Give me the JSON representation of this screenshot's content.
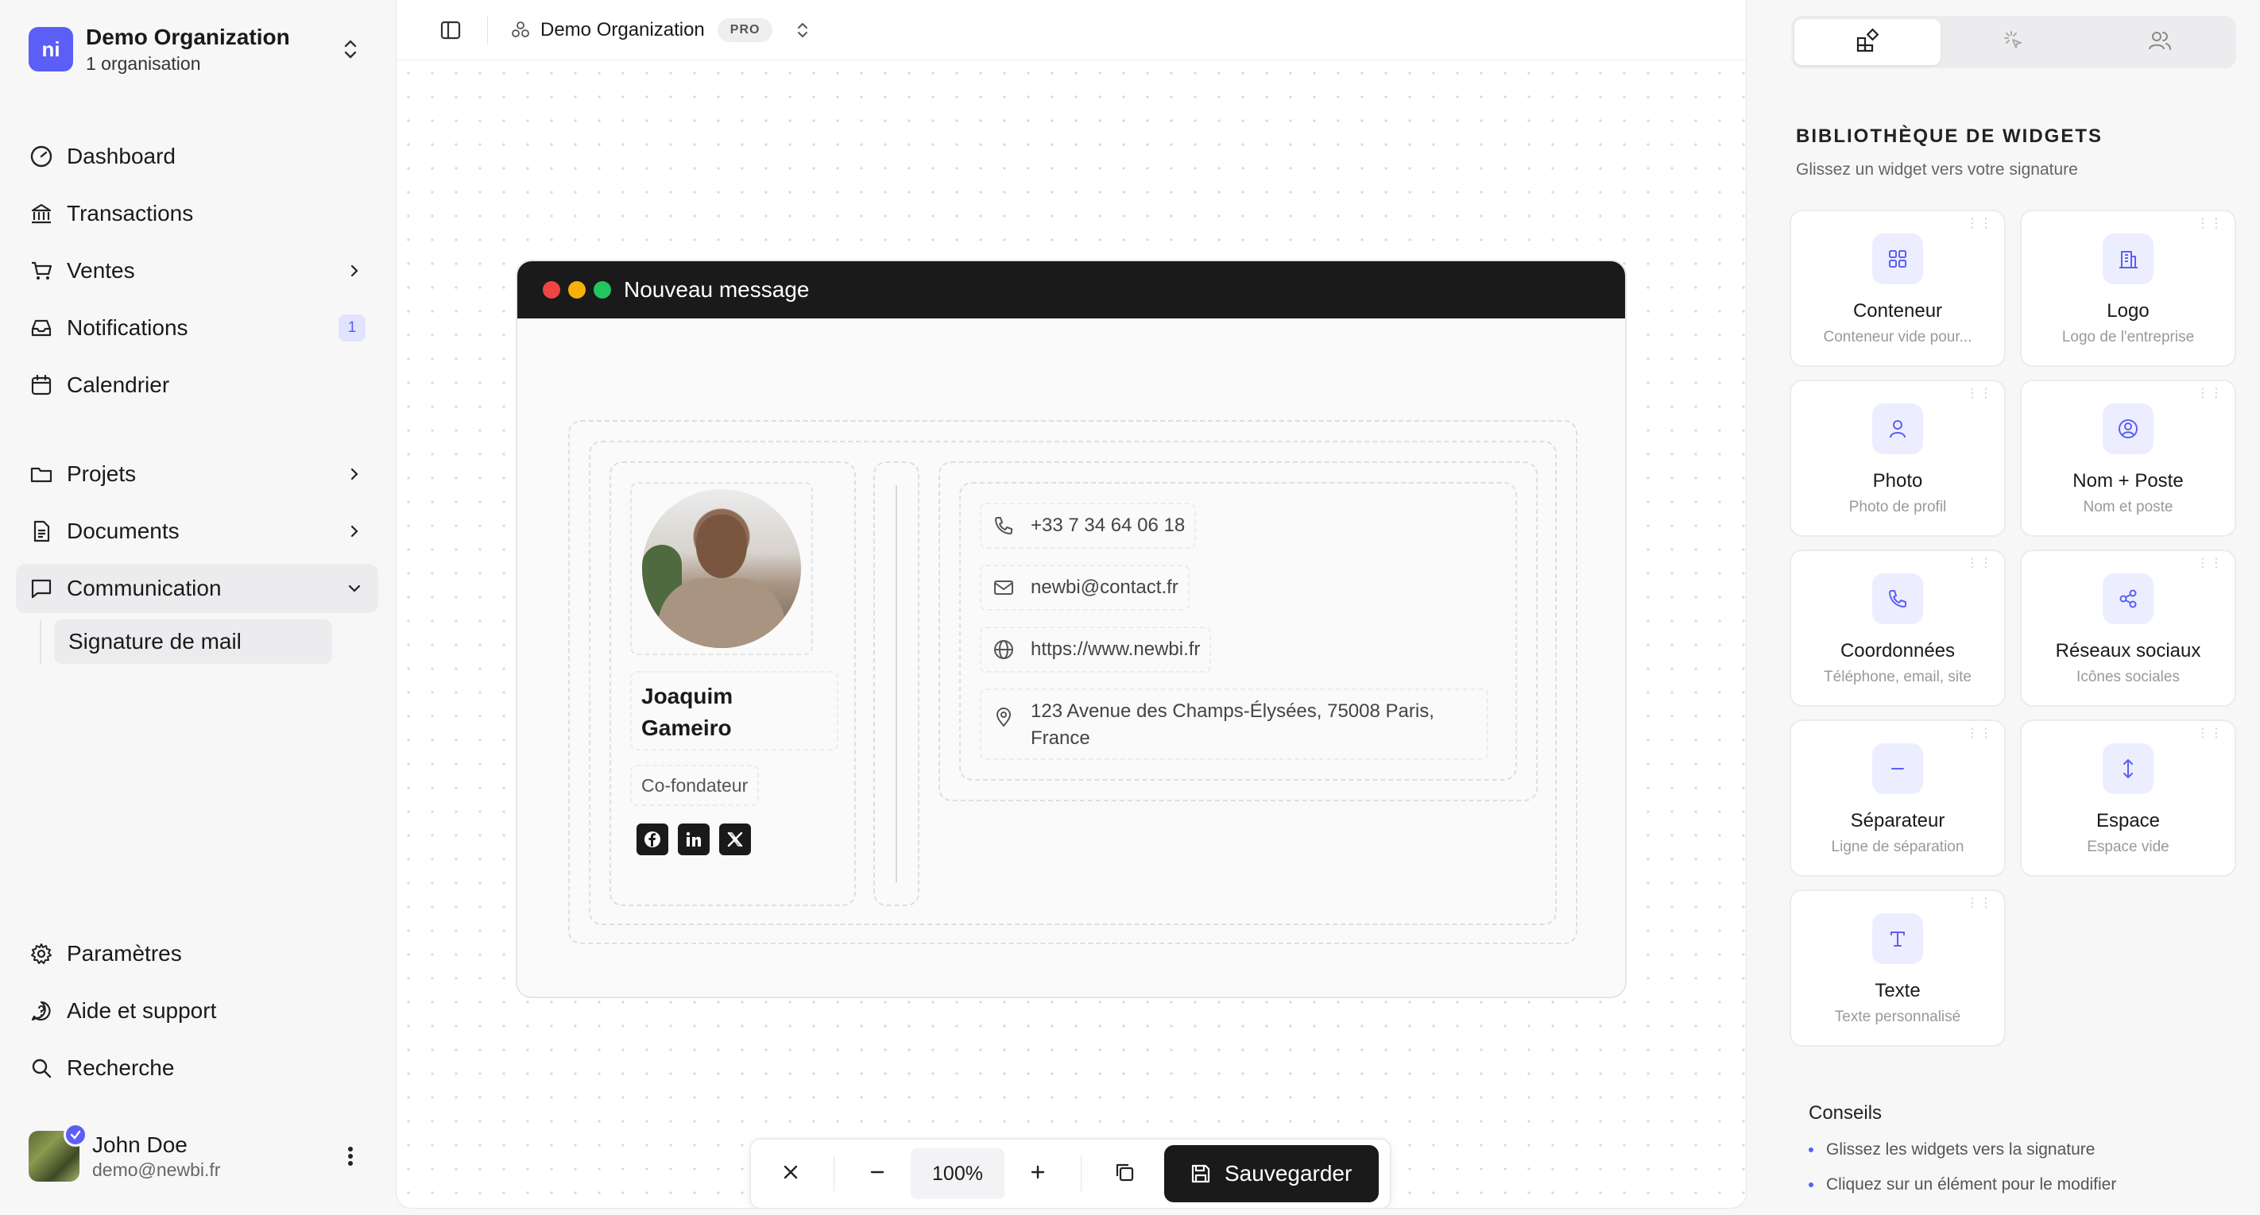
{
  "org": {
    "initials": "ni",
    "name": "Demo Organization",
    "subtitle": "1 organisation"
  },
  "nav": {
    "dashboard": "Dashboard",
    "transactions": "Transactions",
    "ventes": "Ventes",
    "notifications": "Notifications",
    "notifications_badge": "1",
    "calendrier": "Calendrier",
    "projets": "Projets",
    "documents": "Documents",
    "communication": "Communication",
    "signature": "Signature de mail",
    "parametres": "Paramètres",
    "aide": "Aide et support",
    "recherche": "Recherche"
  },
  "user": {
    "name": "John Doe",
    "email": "demo@newbi.fr"
  },
  "topbar": {
    "org_name": "Demo Organization",
    "plan_badge": "PRO"
  },
  "email": {
    "window_title": "Nouveau message",
    "name_line1": "Joaquim",
    "name_line2": "Gameiro",
    "role": "Co-fondateur",
    "phone": "+33 7 34 64 06 18",
    "mail": "newbi@contact.fr",
    "website": "https://www.newbi.fr",
    "address_line1": "123 Avenue des Champs-Élysées, 75008 Paris,",
    "address_line2": "France"
  },
  "toolbar": {
    "zoom": "100%",
    "save_label": "Sauvegarder"
  },
  "library": {
    "title": "BIBLIOTHÈQUE DE WIDGETS",
    "subtitle": "Glissez un widget vers votre signature",
    "widgets": [
      {
        "name": "Conteneur",
        "desc": "Conteneur vide pour...",
        "icon": "grid-icon"
      },
      {
        "name": "Logo",
        "desc": "Logo de l'entreprise",
        "icon": "building-icon"
      },
      {
        "name": "Photo",
        "desc": "Photo de profil",
        "icon": "user-icon"
      },
      {
        "name": "Nom + Poste",
        "desc": "Nom et poste",
        "icon": "user-circle-icon"
      },
      {
        "name": "Coordonnées",
        "desc": "Téléphone, email, site",
        "icon": "phone-icon"
      },
      {
        "name": "Réseaux sociaux",
        "desc": "Icônes sociales",
        "icon": "share-icon"
      },
      {
        "name": "Séparateur",
        "desc": "Ligne de séparation",
        "icon": "minus-icon"
      },
      {
        "name": "Espace",
        "desc": "Espace vide",
        "icon": "vertical-arrows-icon"
      },
      {
        "name": "Texte",
        "desc": "Texte personnalisé",
        "icon": "text-icon"
      }
    ]
  },
  "tips": {
    "title": "Conseils",
    "items": [
      "Glissez les widgets vers la signature",
      "Cliquez sur un élément pour le modifier"
    ]
  },
  "colors": {
    "accent": "#5b5ff5",
    "dark": "#1a1a1a",
    "dot_red": "#ef4444",
    "dot_yellow": "#f5b10b",
    "dot_green": "#22c55e"
  }
}
